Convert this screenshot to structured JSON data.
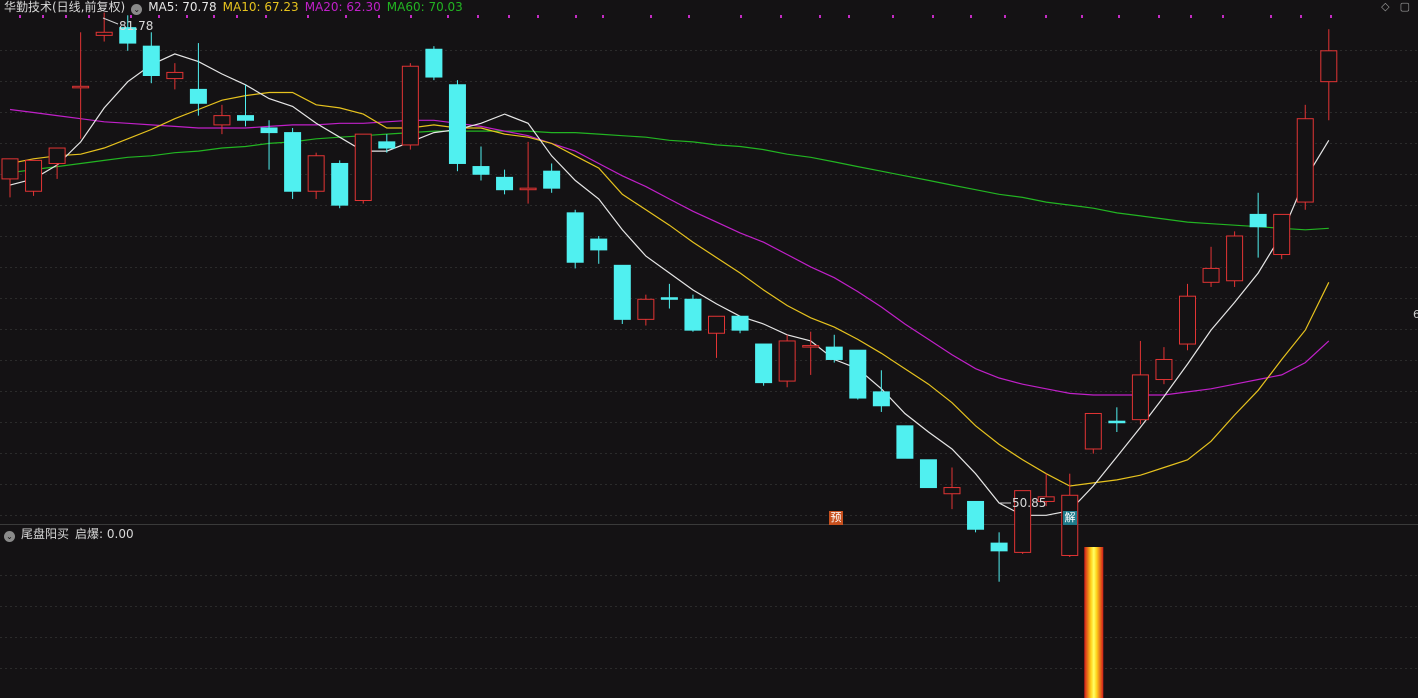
{
  "header": {
    "title": "华勤技术(日线,前复权)",
    "ma5": {
      "label": "MA5:",
      "value": "70.78",
      "color": "#e6e6e6"
    },
    "ma10": {
      "label": "MA10:",
      "value": "67.23",
      "color": "#e6c21e"
    },
    "ma20": {
      "label": "MA20:",
      "value": "62.30",
      "color": "#c020c8"
    },
    "ma60": {
      "label": "MA60:",
      "value": "70.03",
      "color": "#22b422"
    }
  },
  "annotations": {
    "high": "81.78",
    "low": "50.85",
    "marker_yu": "预",
    "marker_jie": "解",
    "edge_label": "6"
  },
  "indicator": {
    "name": "尾盘阳买",
    "field_label": "启爆:",
    "field_value": "0.00"
  },
  "icons": [
    "collapse-icon",
    "diamond-icon",
    "window-icon"
  ],
  "colors": {
    "up": "#e23434",
    "down": "#50f0f0",
    "background": "#141214",
    "grid": "#2b2b2b",
    "dots": "#c42bc4"
  },
  "chart_data": {
    "type": "candlestick",
    "x": [
      1,
      2,
      3,
      4,
      5,
      6,
      7,
      8,
      9,
      10,
      11,
      12,
      13,
      14,
      15,
      16,
      17,
      18,
      19,
      20,
      21,
      22,
      23,
      24,
      25,
      26,
      27,
      28,
      29,
      30,
      31,
      32,
      33,
      34,
      35,
      36,
      37,
      38,
      39,
      40,
      41,
      42,
      43,
      44,
      45,
      46,
      47,
      48,
      49,
      50,
      51,
      52,
      53,
      54,
      55,
      56
    ],
    "candles": [
      [
        71.0,
        72.3,
        69.8,
        71.8
      ],
      [
        70.2,
        72.2,
        69.9,
        71.4
      ],
      [
        72.0,
        73.0,
        71.0,
        72.3
      ],
      [
        76.9,
        77.0,
        73.6,
        80.5
      ],
      [
        80.3,
        80.5,
        79.9,
        81.78
      ],
      [
        80.8,
        79.8,
        79.3,
        81.6
      ],
      [
        79.6,
        77.7,
        77.2,
        80.5
      ],
      [
        77.5,
        77.9,
        76.8,
        78.5
      ],
      [
        76.8,
        75.9,
        75.1,
        79.8
      ],
      [
        74.5,
        75.1,
        73.9,
        75.8
      ],
      [
        75.1,
        74.8,
        74.4,
        77.1
      ],
      [
        74.3,
        74.0,
        71.6,
        74.8
      ],
      [
        74.0,
        70.2,
        69.7,
        74.3
      ],
      [
        70.2,
        72.5,
        69.7,
        72.7
      ],
      [
        72.0,
        69.3,
        69.1,
        72.2
      ],
      [
        69.6,
        73.9,
        69.4,
        73.9
      ],
      [
        73.4,
        73.0,
        72.7,
        73.9
      ],
      [
        73.2,
        78.3,
        72.9,
        78.5
      ],
      [
        79.4,
        77.6,
        77.4,
        79.6
      ],
      [
        77.1,
        72.0,
        71.5,
        77.4
      ],
      [
        71.8,
        71.3,
        70.9,
        73.1
      ],
      [
        71.1,
        70.3,
        70.0,
        71.6
      ],
      [
        70.3,
        70.4,
        69.4,
        73.4
      ],
      [
        71.5,
        70.4,
        70.1,
        72.0
      ],
      [
        68.8,
        65.6,
        65.2,
        69.0
      ],
      [
        67.1,
        66.4,
        65.5,
        67.3
      ],
      [
        65.4,
        61.9,
        61.6,
        65.4
      ],
      [
        61.9,
        63.2,
        61.5,
        63.5
      ],
      [
        63.3,
        63.2,
        62.6,
        64.2
      ],
      [
        63.2,
        61.2,
        61.1,
        63.5
      ],
      [
        61.0,
        62.1,
        59.4,
        62.1
      ],
      [
        62.1,
        61.2,
        61.0,
        62.1
      ],
      [
        60.3,
        57.8,
        57.6,
        60.3
      ],
      [
        57.9,
        60.5,
        57.5,
        60.9
      ],
      [
        60.2,
        60.2,
        58.3,
        61.1
      ],
      [
        60.1,
        59.3,
        59.1,
        60.9
      ],
      [
        59.9,
        56.8,
        56.7,
        59.9
      ],
      [
        57.2,
        56.3,
        55.9,
        58.6
      ],
      [
        55.0,
        52.9,
        52.9,
        55.0
      ],
      [
        52.8,
        51.0,
        51.0,
        52.8
      ],
      [
        50.6,
        51.0,
        49.6,
        52.3
      ],
      [
        50.1,
        48.3,
        48.1,
        50.1
      ],
      [
        47.4,
        46.9,
        44.9,
        48.1
      ],
      [
        46.8,
        50.8,
        46.7,
        50.8
      ],
      [
        50.1,
        50.4,
        49.8,
        51.9
      ],
      [
        46.6,
        50.5,
        46.5,
        51.9
      ],
      [
        53.5,
        55.8,
        53.2,
        55.8
      ],
      [
        55.3,
        55.2,
        54.6,
        56.2
      ],
      [
        55.4,
        58.3,
        55.1,
        60.5
      ],
      [
        58.0,
        59.3,
        57.7,
        60.1
      ],
      [
        60.3,
        63.4,
        59.9,
        64.2
      ],
      [
        64.3,
        65.2,
        64.0,
        66.6
      ],
      [
        64.4,
        67.3,
        64.0,
        67.6
      ],
      [
        68.7,
        67.9,
        65.9,
        70.1
      ],
      [
        66.1,
        68.7,
        65.8,
        68.7
      ],
      [
        69.5,
        74.9,
        69.0,
        75.8
      ],
      [
        77.3,
        79.3,
        74.8,
        80.7
      ]
    ],
    "ma5": [
      70.6,
      71.0,
      71.9,
      73.4,
      75.6,
      77.3,
      78.4,
      79.1,
      78.6,
      77.8,
      77.1,
      76.2,
      75.7,
      74.6,
      73.7,
      72.8,
      72.8,
      73.4,
      74.0,
      74.2,
      74.6,
      75.2,
      74.6,
      72.5,
      70.9,
      69.7,
      67.7,
      66.0,
      64.9,
      63.8,
      62.9,
      62.1,
      61.6,
      60.9,
      60.5,
      59.3,
      58.7,
      57.4,
      55.8,
      54.6,
      53.5,
      51.9,
      50.0,
      49.2,
      49.2,
      49.5,
      51.1,
      53.0,
      54.9,
      56.9,
      59.0,
      61.2,
      63.0,
      64.9,
      67.4,
      71.0,
      73.5
    ],
    "ma10": [
      72.0,
      72.3,
      72.5,
      72.6,
      73.0,
      73.6,
      74.2,
      74.9,
      75.5,
      76.1,
      76.4,
      76.6,
      76.6,
      75.8,
      75.6,
      75.2,
      74.3,
      74.3,
      74.5,
      74.3,
      74.3,
      73.9,
      73.7,
      73.3,
      72.5,
      71.7,
      70.0,
      69.0,
      68.0,
      66.9,
      65.9,
      64.9,
      63.8,
      62.8,
      62.0,
      61.4,
      60.6,
      59.7,
      58.7,
      57.7,
      56.5,
      55.0,
      53.8,
      52.8,
      51.9,
      51.1,
      51.3,
      51.5,
      51.8,
      52.3,
      52.8,
      54.0,
      55.7,
      57.3,
      59.3,
      61.2,
      64.3
    ],
    "ma20": [
      75.5,
      75.3,
      75.1,
      74.9,
      74.7,
      74.6,
      74.5,
      74.4,
      74.3,
      74.3,
      74.3,
      74.4,
      74.5,
      74.5,
      74.6,
      74.6,
      74.7,
      74.8,
      74.8,
      74.6,
      74.4,
      74.1,
      73.8,
      73.3,
      72.8,
      72.0,
      71.2,
      70.5,
      69.7,
      68.9,
      68.2,
      67.5,
      66.9,
      66.1,
      65.3,
      64.6,
      63.7,
      62.7,
      61.6,
      60.6,
      59.6,
      58.7,
      58.1,
      57.7,
      57.4,
      57.1,
      57.0,
      57.0,
      57.0,
      57.0,
      57.2,
      57.4,
      57.7,
      58.0,
      58.3,
      59.1,
      60.5
    ],
    "ma60": [
      71.4,
      71.6,
      71.8,
      72.0,
      72.2,
      72.4,
      72.5,
      72.7,
      72.8,
      73.0,
      73.1,
      73.3,
      73.4,
      73.6,
      73.7,
      73.8,
      73.9,
      74.0,
      74.1,
      74.1,
      74.1,
      74.1,
      74.1,
      74.0,
      74.0,
      73.9,
      73.8,
      73.7,
      73.5,
      73.4,
      73.2,
      73.1,
      72.9,
      72.6,
      72.4,
      72.1,
      71.8,
      71.5,
      71.2,
      70.9,
      70.6,
      70.3,
      70.0,
      69.8,
      69.5,
      69.3,
      69.1,
      68.8,
      68.6,
      68.4,
      68.2,
      68.1,
      68.0,
      67.9,
      67.8,
      67.7,
      67.8
    ],
    "volume_bars": [
      {
        "x": 46,
        "value": 1
      }
    ],
    "high_label": "81.78",
    "low_label": "50.85",
    "ylim": [
      45,
      84
    ]
  }
}
